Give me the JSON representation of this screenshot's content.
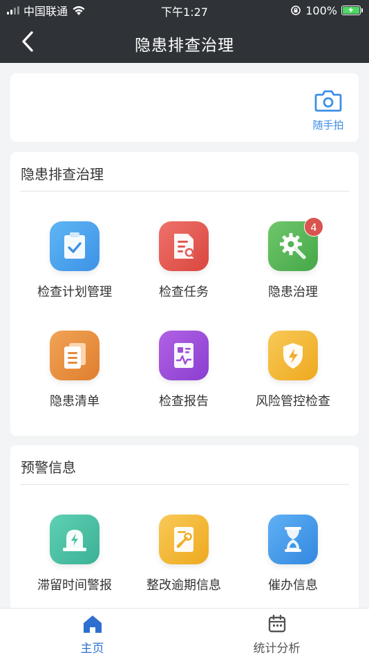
{
  "status_bar": {
    "carrier": "中国联通",
    "time": "下午1:27",
    "battery": "100%"
  },
  "nav": {
    "title": "隐患排查治理",
    "back_icon": "chevron-left-icon"
  },
  "quick": {
    "camera_label": "随手拍",
    "camera_icon": "camera-icon"
  },
  "section1": {
    "title": "隐患排查治理",
    "items": [
      {
        "label": "检查计划管理",
        "icon": "clipboard-check-icon",
        "color": "#4aa3ee"
      },
      {
        "label": "检查任务",
        "icon": "document-search-icon",
        "color": "#e05a55"
      },
      {
        "label": "隐患治理",
        "icon": "gear-wrench-icon",
        "color": "#5cb85c",
        "badge": "4"
      },
      {
        "label": "隐患清单",
        "icon": "document-list-icon",
        "color": "#e8893a"
      },
      {
        "label": "检查报告",
        "icon": "report-pulse-icon",
        "color": "#9d4fd6"
      },
      {
        "label": "风险管控检查",
        "icon": "shield-bolt-icon",
        "color": "#f3b534"
      }
    ]
  },
  "section2": {
    "title": "预警信息",
    "items": [
      {
        "label": "滞留时间警报",
        "icon": "alarm-light-icon",
        "color": "#4cc2a4"
      },
      {
        "label": "整改逾期信息",
        "icon": "wrench-document-icon",
        "color": "#f3b534"
      },
      {
        "label": "催办信息",
        "icon": "hourglass-icon",
        "color": "#3d9ae8"
      }
    ]
  },
  "tabs": {
    "home_label": "主页",
    "stats_label": "统计分析"
  }
}
